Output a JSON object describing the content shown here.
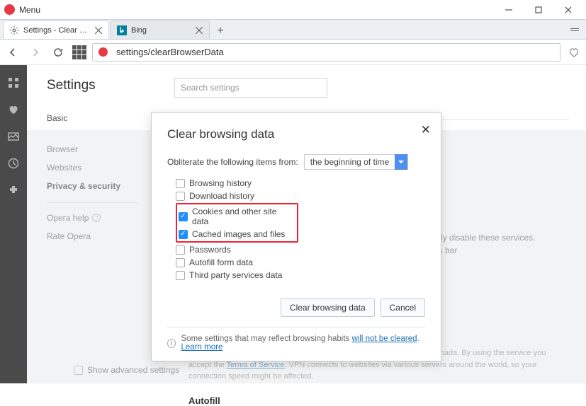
{
  "window": {
    "menu_label": "Menu"
  },
  "tabs": {
    "items": [
      {
        "label": "Settings - Clear browsing ..."
      },
      {
        "label": "Bing"
      }
    ]
  },
  "address_bar": {
    "url": "settings/clearBrowserData"
  },
  "settings": {
    "page_title": "Settings",
    "search_placeholder": "Search settings",
    "sidebar": {
      "basic": "Basic",
      "browser": "Browser",
      "websites": "Websites",
      "privacy": "Privacy & security",
      "help": "Opera help",
      "rate": "Rate Opera"
    },
    "advanced_label": "Show advanced settings",
    "bg_line1": "nally disable these services.",
    "bg_line2": "ess bar",
    "disclaimer_prefix": "Secure proxy provided by SurfEasy Inc., an Opera company based in Canada. By using the service you accept the ",
    "disclaimer_link": "Terms of Service",
    "disclaimer_suffix": ". VPN connects to websites via various servers around the world, so your connection speed might be affected.",
    "autofill_header": "Autofill"
  },
  "modal": {
    "title": "Clear browsing data",
    "time_label": "Obliterate the following items from:",
    "time_value": "the beginning of time",
    "options": {
      "browsing": "Browsing history",
      "download": "Download history",
      "cookies": "Cookies and other site data",
      "cached": "Cached images and files",
      "passwords": "Passwords",
      "autofill": "Autofill form data",
      "thirdparty": "Third party services data"
    },
    "clear_btn": "Clear browsing data",
    "cancel_btn": "Cancel",
    "info_prefix": "Some settings that may reflect browsing habits ",
    "info_link1": "will not be cleared",
    "info_sep": ". ",
    "info_link2": "Learn more"
  }
}
